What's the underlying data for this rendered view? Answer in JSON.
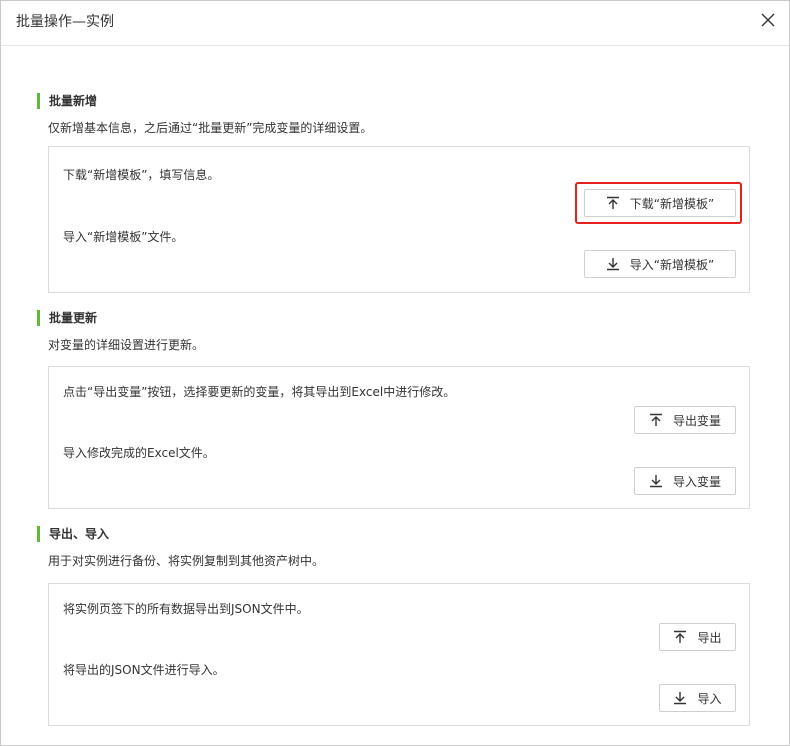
{
  "dialog": {
    "title": "批量操作—实例"
  },
  "sections": [
    {
      "title": "批量新增",
      "desc": "仅新增基本信息，之后通过“批量更新”完成变量的详细设置。",
      "line1": "下载“新增模板”，填写信息。",
      "btn1": "下载“新增模板”",
      "line2": "导入“新增模板”文件。",
      "btn2": "导入“新增模板”"
    },
    {
      "title": "批量更新",
      "desc": "对变量的详细设置进行更新。",
      "line1": "点击“导出变量”按钮，选择要更新的变量，将其导出到Excel中进行修改。",
      "btn1": "导出变量",
      "line2": "导入修改完成的Excel文件。",
      "btn2": "导入变量"
    },
    {
      "title": "导出、导入",
      "desc": "用于对实例进行备份、将实例复制到其他资产树中。",
      "line1": "将实例页签下的所有数据导出到JSON文件中。",
      "btn1": "导出",
      "line2": "将导出的JSON文件进行导入。",
      "btn2": "导入"
    }
  ],
  "icons": {
    "close": "close-icon",
    "upload": "upload-icon",
    "download": "download-icon"
  },
  "colors": {
    "accent": "#62b83a",
    "highlight": "#e5211d"
  }
}
